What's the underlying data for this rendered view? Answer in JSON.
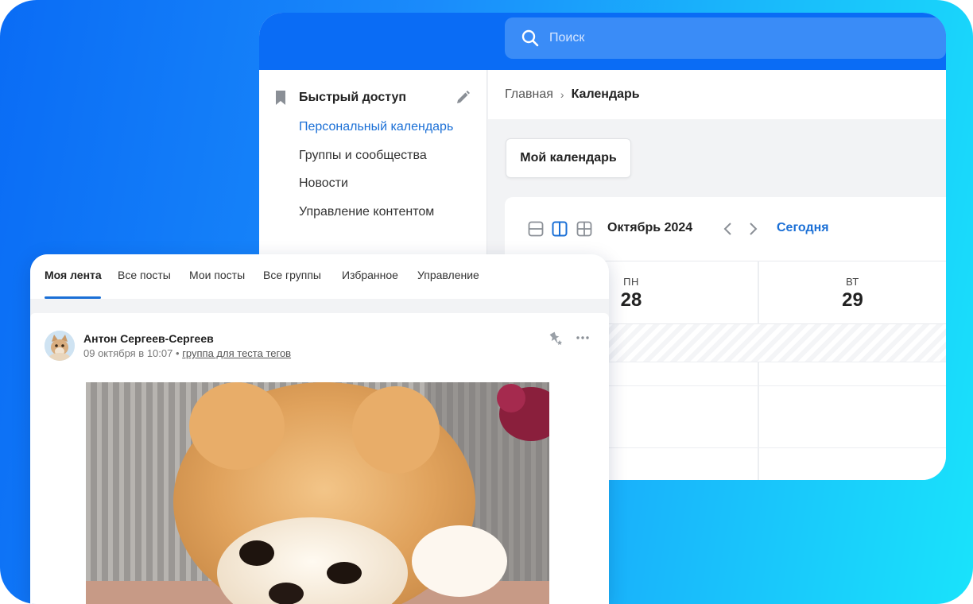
{
  "calendar_window": {
    "search": {
      "placeholder": "Поиск"
    },
    "quick_access": {
      "title": "Быстрый доступ",
      "items": [
        {
          "label": "Персональный календарь",
          "active": true
        },
        {
          "label": "Группы и сообщества",
          "active": false
        },
        {
          "label": "Новости",
          "active": false
        },
        {
          "label": "Управление контентом",
          "active": false
        }
      ]
    },
    "breadcrumb": {
      "home": "Главная",
      "separator": "›",
      "current": "Календарь"
    },
    "my_calendar_button": "Мой календарь",
    "toolbar": {
      "views": [
        "day-view-icon",
        "week-view-icon",
        "month-view-icon"
      ],
      "active_view": "week-view-icon",
      "month_label": "Октябрь 2024",
      "today_label": "Сегодня"
    },
    "days": [
      {
        "dow": "ПН",
        "num": "28"
      },
      {
        "dow": "ВТ",
        "num": "29"
      }
    ]
  },
  "feed_window": {
    "tabs": [
      {
        "label": "Моя лента",
        "active": true
      },
      {
        "label": "Все посты",
        "active": false
      },
      {
        "label": "Мои посты",
        "active": false
      },
      {
        "label": "Все группы",
        "active": false
      },
      {
        "label": "Избранное",
        "active": false
      },
      {
        "label": "Управление",
        "active": false
      }
    ],
    "post": {
      "author": "Антон Сергеев-Сергеев",
      "date": "09 октября в 10:07",
      "bullet": "•",
      "group": "группа для теста тегов",
      "image": "pomeranian-puppy-photo"
    }
  },
  "colors": {
    "brand_blue": "#0a6cf5",
    "link_blue": "#1a6fd6",
    "gradient_end": "#19e3fb"
  }
}
